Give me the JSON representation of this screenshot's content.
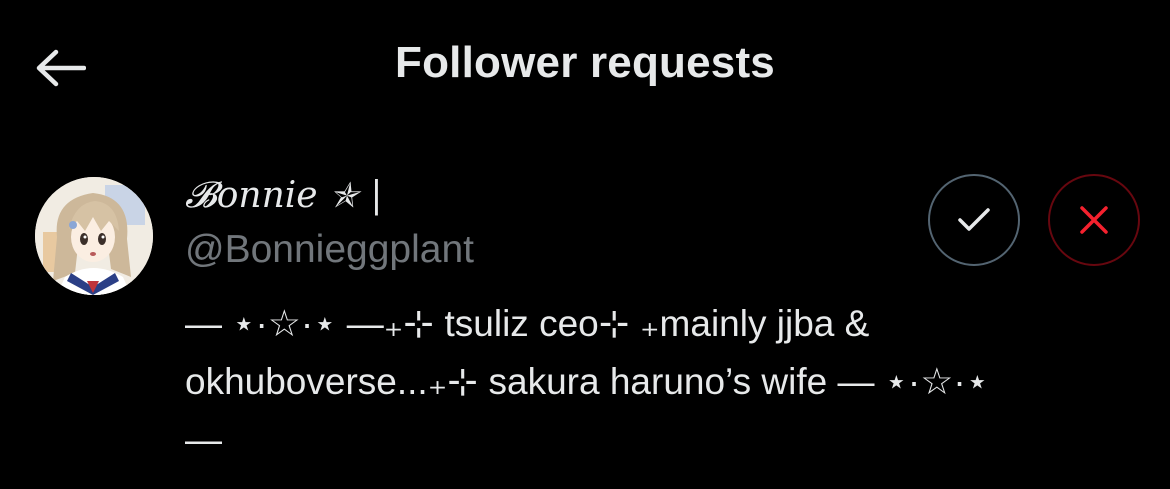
{
  "header": {
    "title": "Follower requests",
    "back_icon": "arrow-left-icon"
  },
  "request": {
    "display_name": "𝓑onnie ✯ |",
    "handle": "@Bonnieggplant",
    "bio_lines": [
      "— ⋆·☆·⋆ —₊⊹ tsuliz ceo⊹ ₊mainly jjba &",
      "okhuboverse...₊⊹ sakura haruno’s wife — ⋆·☆·⋆",
      "—"
    ],
    "accept_icon": "checkmark-icon",
    "decline_icon": "close-icon"
  },
  "colors": {
    "background": "#000000",
    "primary_text": "#e7e9ea",
    "secondary_text": "#71767b",
    "accept_border": "#536471",
    "decline_border": "#67070f",
    "decline_icon": "#f4212e"
  }
}
